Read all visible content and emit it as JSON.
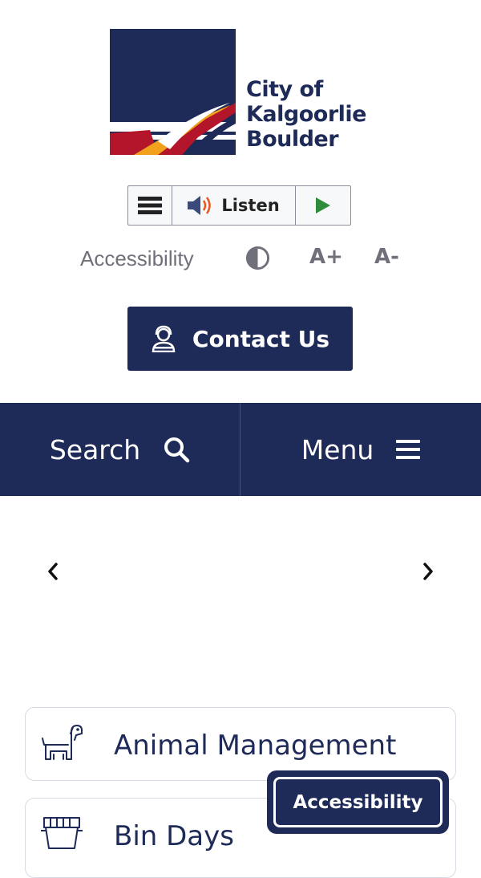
{
  "logo": {
    "lines": [
      "City of",
      "Kalgoorlie",
      "Boulder"
    ]
  },
  "listen_toolbar": {
    "menu_icon": "hamburger-icon",
    "speaker_icon": "speaker-icon",
    "listen_label": "Listen",
    "play_icon": "play-icon"
  },
  "accessibility_bar": {
    "label": "Accessibility",
    "contrast_icon": "contrast-icon",
    "increase_label": "A+",
    "decrease_label": "A-"
  },
  "contact": {
    "label": "Contact Us",
    "icon": "contact-person-icon"
  },
  "nav": {
    "search_label": "Search",
    "search_icon": "search-icon",
    "menu_label": "Menu",
    "menu_icon": "hamburger-icon"
  },
  "carousel": {
    "prev_icon": "chevron-left-icon",
    "next_icon": "chevron-right-icon"
  },
  "quick_links": [
    {
      "label": "Animal Management",
      "icon": "dog-icon"
    },
    {
      "label": "Bin Days",
      "icon": "bin-icon"
    }
  ],
  "floating_accessibility": {
    "label": "Accessibility"
  },
  "colors": {
    "brand_navy": "#1e2a57",
    "text_grey": "#6f7079",
    "play_green": "#2e8b3a",
    "logo_red": "#b3162a",
    "logo_orange": "#f2a11d"
  }
}
